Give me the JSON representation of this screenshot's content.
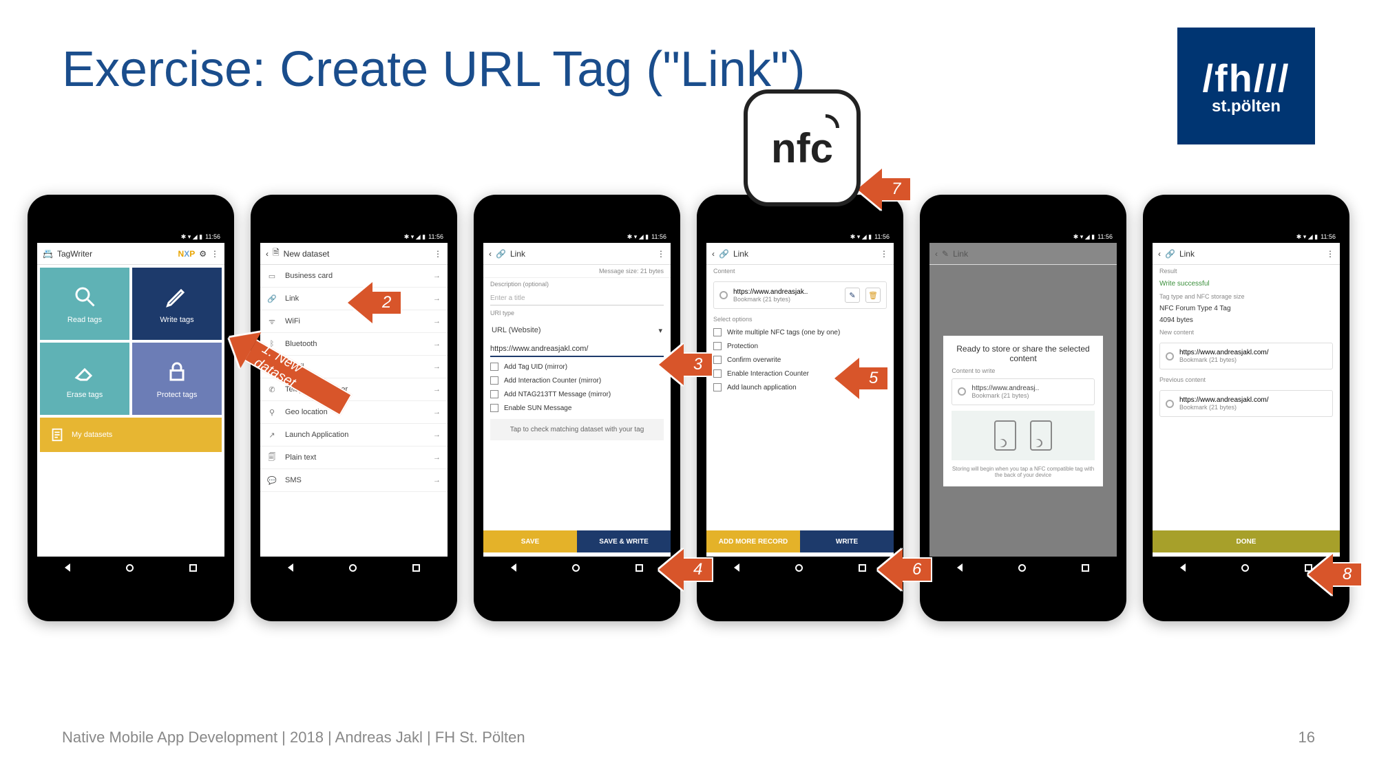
{
  "slide": {
    "title": "Exercise: Create URL Tag (\"Link\")",
    "footer": "Native Mobile App Development | 2018 | Andreas Jakl | FH St. Pölten",
    "page": "16"
  },
  "logo": {
    "main": "/fh///",
    "sub": "st.pölten"
  },
  "nfc_label": "nfc",
  "status_time": "11:56",
  "phone1": {
    "app_title": "TagWriter",
    "tiles": {
      "read": "Read tags",
      "write": "Write tags",
      "erase": "Erase tags",
      "protect": "Protect tags",
      "datasets": "My datasets"
    }
  },
  "phone2": {
    "title": "New dataset",
    "items": [
      "Business card",
      "Link",
      "WiFi",
      "Bluetooth",
      "Email",
      "Telephone number",
      "Geo location",
      "Launch Application",
      "Plain text",
      "SMS"
    ]
  },
  "phone3": {
    "title": "Link",
    "message_size": "Message size: 21 bytes",
    "desc_label": "Description (optional)",
    "desc_placeholder": "Enter a title",
    "uri_type_label": "URI type",
    "uri_type_value": "URL (Website)",
    "url_value": "https://www.andreasjakl.com/",
    "checks": [
      "Add Tag UID (mirror)",
      "Add Interaction Counter (mirror)",
      "Add NTAG213TT Message (mirror)",
      "Enable SUN Message"
    ],
    "hint": "Tap to check matching dataset with your tag",
    "save": "SAVE",
    "save_write": "SAVE & WRITE"
  },
  "phone4": {
    "title": "Link",
    "content_label": "Content",
    "bookmark_url": "https://www.andreasjak..",
    "bookmark_sub": "Bookmark (21 bytes)",
    "select_label": "Select options",
    "options": [
      "Write multiple NFC tags (one by one)",
      "Protection",
      "Confirm overwrite",
      "Enable Interaction Counter",
      "Add launch application"
    ],
    "add_more": "ADD MORE RECORD",
    "write": "WRITE"
  },
  "phone5": {
    "title": "Link",
    "dlg_title": "Ready to store or share the selected content",
    "dlg_sub": "Content to write",
    "bookmark_url": "https://www.andreasj..",
    "bookmark_sub": "Bookmark (21 bytes)",
    "foot": "Storing will begin when you tap a NFC compatible tag with the back of your device"
  },
  "phone6": {
    "title": "Link",
    "result_label": "Result",
    "result_value": "Write successful",
    "tag_type_label": "Tag type and NFC storage size",
    "tag_type_value": "NFC Forum Type 4 Tag",
    "tag_size": "4094 bytes",
    "new_label": "New content",
    "prev_label": "Previous content",
    "url": "https://www.andreasjakl.com/",
    "sub": "Bookmark (21 bytes)",
    "done": "DONE"
  },
  "arrows": {
    "a1": "1. New dataset",
    "a2": "2",
    "a3": "3",
    "a4": "4",
    "a5": "5",
    "a6": "6",
    "a7": "7",
    "a8": "8"
  }
}
